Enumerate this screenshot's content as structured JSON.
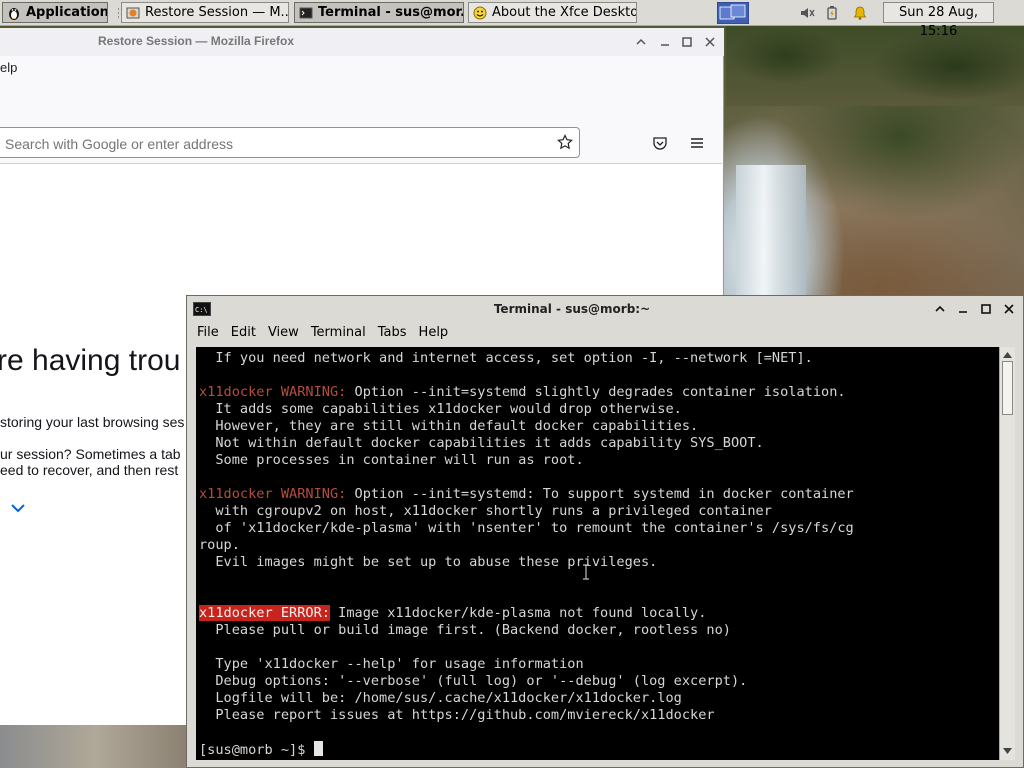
{
  "panel": {
    "applications_label": "Applications",
    "tasks": [
      {
        "label": "Restore Session — M...",
        "icon": "firefox-icon",
        "active": false
      },
      {
        "label": "Terminal - sus@mor...",
        "icon": "terminal-icon",
        "active": true
      },
      {
        "label": "About the Xfce Deskto...",
        "icon": "smiley-icon",
        "active": false
      }
    ],
    "tray_icons": [
      "workspace-pager-icon",
      "volume-muted-icon",
      "power-icon",
      "notification-bell-icon"
    ],
    "clock": "Sun 28 Aug, 15:16"
  },
  "firefox": {
    "window_title": "Restore Session — Mozilla Firefox",
    "menu_partial": "elp",
    "urlbar_placeholder": "Search with Google or enter address",
    "heading_partial": "re having trou",
    "para1_partial": "storing your last browsing ses",
    "para2_line1_partial": "ur session? Sometimes a tab",
    "para2_line2_partial": "eed to recover, and then rest"
  },
  "terminal": {
    "window_title": "Terminal - sus@morb:~",
    "menu": [
      "File",
      "Edit",
      "View",
      "Terminal",
      "Tabs",
      "Help"
    ],
    "lines": [
      {
        "parts": [
          {
            "t": "  If you need network and internet access, set option -I, --network [=NET]."
          }
        ]
      },
      {
        "parts": [
          {
            "t": ""
          }
        ]
      },
      {
        "parts": [
          {
            "t": "x11docker WARNING:",
            "c": "warn"
          },
          {
            "t": " Option --init=systemd slightly degrades container isolation."
          }
        ]
      },
      {
        "parts": [
          {
            "t": "  It adds some capabilities x11docker would drop otherwise."
          }
        ]
      },
      {
        "parts": [
          {
            "t": "  However, they are still within default docker capabilities."
          }
        ]
      },
      {
        "parts": [
          {
            "t": "  Not within default docker capabilities it adds capability SYS_BOOT."
          }
        ]
      },
      {
        "parts": [
          {
            "t": "  Some processes in container will run as root."
          }
        ]
      },
      {
        "parts": [
          {
            "t": ""
          }
        ]
      },
      {
        "parts": [
          {
            "t": "x11docker WARNING:",
            "c": "warn"
          },
          {
            "t": " Option --init=systemd: To support systemd in docker container"
          }
        ]
      },
      {
        "parts": [
          {
            "t": "  with cgroupv2 on host, x11docker shortly runs a privileged container"
          }
        ]
      },
      {
        "parts": [
          {
            "t": "  of 'x11docker/kde-plasma' with 'nsenter' to remount the container's /sys/fs/cg"
          }
        ]
      },
      {
        "parts": [
          {
            "t": "roup."
          }
        ]
      },
      {
        "parts": [
          {
            "t": "  Evil images might be set up to abuse these privileges."
          }
        ]
      },
      {
        "parts": [
          {
            "t": ""
          }
        ]
      },
      {
        "parts": [
          {
            "t": ""
          }
        ]
      },
      {
        "parts": [
          {
            "t": "x11docker ERROR:",
            "c": "err"
          },
          {
            "t": " Image x11docker/kde-plasma not found locally."
          }
        ]
      },
      {
        "parts": [
          {
            "t": "  Please pull or build image first. (Backend docker, rootless no)"
          }
        ]
      },
      {
        "parts": [
          {
            "t": ""
          }
        ]
      },
      {
        "parts": [
          {
            "t": "  Type 'x11docker --help' for usage information"
          }
        ]
      },
      {
        "parts": [
          {
            "t": "  Debug options: '--verbose' (full log) or '--debug' (log excerpt)."
          }
        ]
      },
      {
        "parts": [
          {
            "t": "  Logfile will be: /home/sus/.cache/x11docker/x11docker.log"
          }
        ]
      },
      {
        "parts": [
          {
            "t": "  Please report issues at https://github.com/mviereck/x11docker"
          }
        ]
      },
      {
        "parts": [
          {
            "t": ""
          }
        ]
      },
      {
        "parts": [
          {
            "t": "[sus@morb ~]$ "
          }
        ],
        "cursor": true
      }
    ]
  }
}
